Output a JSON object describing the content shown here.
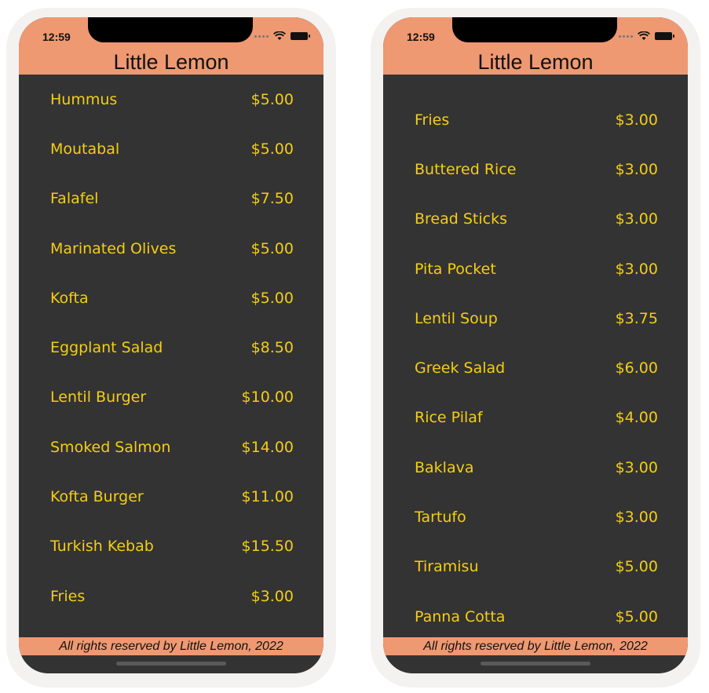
{
  "status_time": "12:59",
  "app_title": "Little Lemon",
  "footer_text": "All rights reserved by Little Lemon, 2022",
  "colors": {
    "header": "#ee9972",
    "background": "#333333",
    "text": "#f4ce14"
  },
  "left_menu": [
    {
      "name": "Hummus",
      "price": "$5.00"
    },
    {
      "name": "Moutabal",
      "price": "$5.00"
    },
    {
      "name": "Falafel",
      "price": "$7.50"
    },
    {
      "name": "Marinated Olives",
      "price": "$5.00"
    },
    {
      "name": "Kofta",
      "price": "$5.00"
    },
    {
      "name": "Eggplant Salad",
      "price": "$8.50"
    },
    {
      "name": "Lentil Burger",
      "price": "$10.00"
    },
    {
      "name": "Smoked Salmon",
      "price": "$14.00"
    },
    {
      "name": "Kofta Burger",
      "price": "$11.00"
    },
    {
      "name": "Turkish Kebab",
      "price": "$15.50"
    },
    {
      "name": "Fries",
      "price": "$3.00"
    }
  ],
  "right_menu": [
    {
      "name": "Fries",
      "price": "$3.00"
    },
    {
      "name": "Buttered Rice",
      "price": "$3.00"
    },
    {
      "name": "Bread Sticks",
      "price": "$3.00"
    },
    {
      "name": "Pita Pocket",
      "price": "$3.00"
    },
    {
      "name": "Lentil Soup",
      "price": "$3.75"
    },
    {
      "name": "Greek Salad",
      "price": "$6.00"
    },
    {
      "name": "Rice Pilaf",
      "price": "$4.00"
    },
    {
      "name": "Baklava",
      "price": "$3.00"
    },
    {
      "name": "Tartufo",
      "price": "$3.00"
    },
    {
      "name": "Tiramisu",
      "price": "$5.00"
    },
    {
      "name": "Panna Cotta",
      "price": "$5.00"
    }
  ]
}
